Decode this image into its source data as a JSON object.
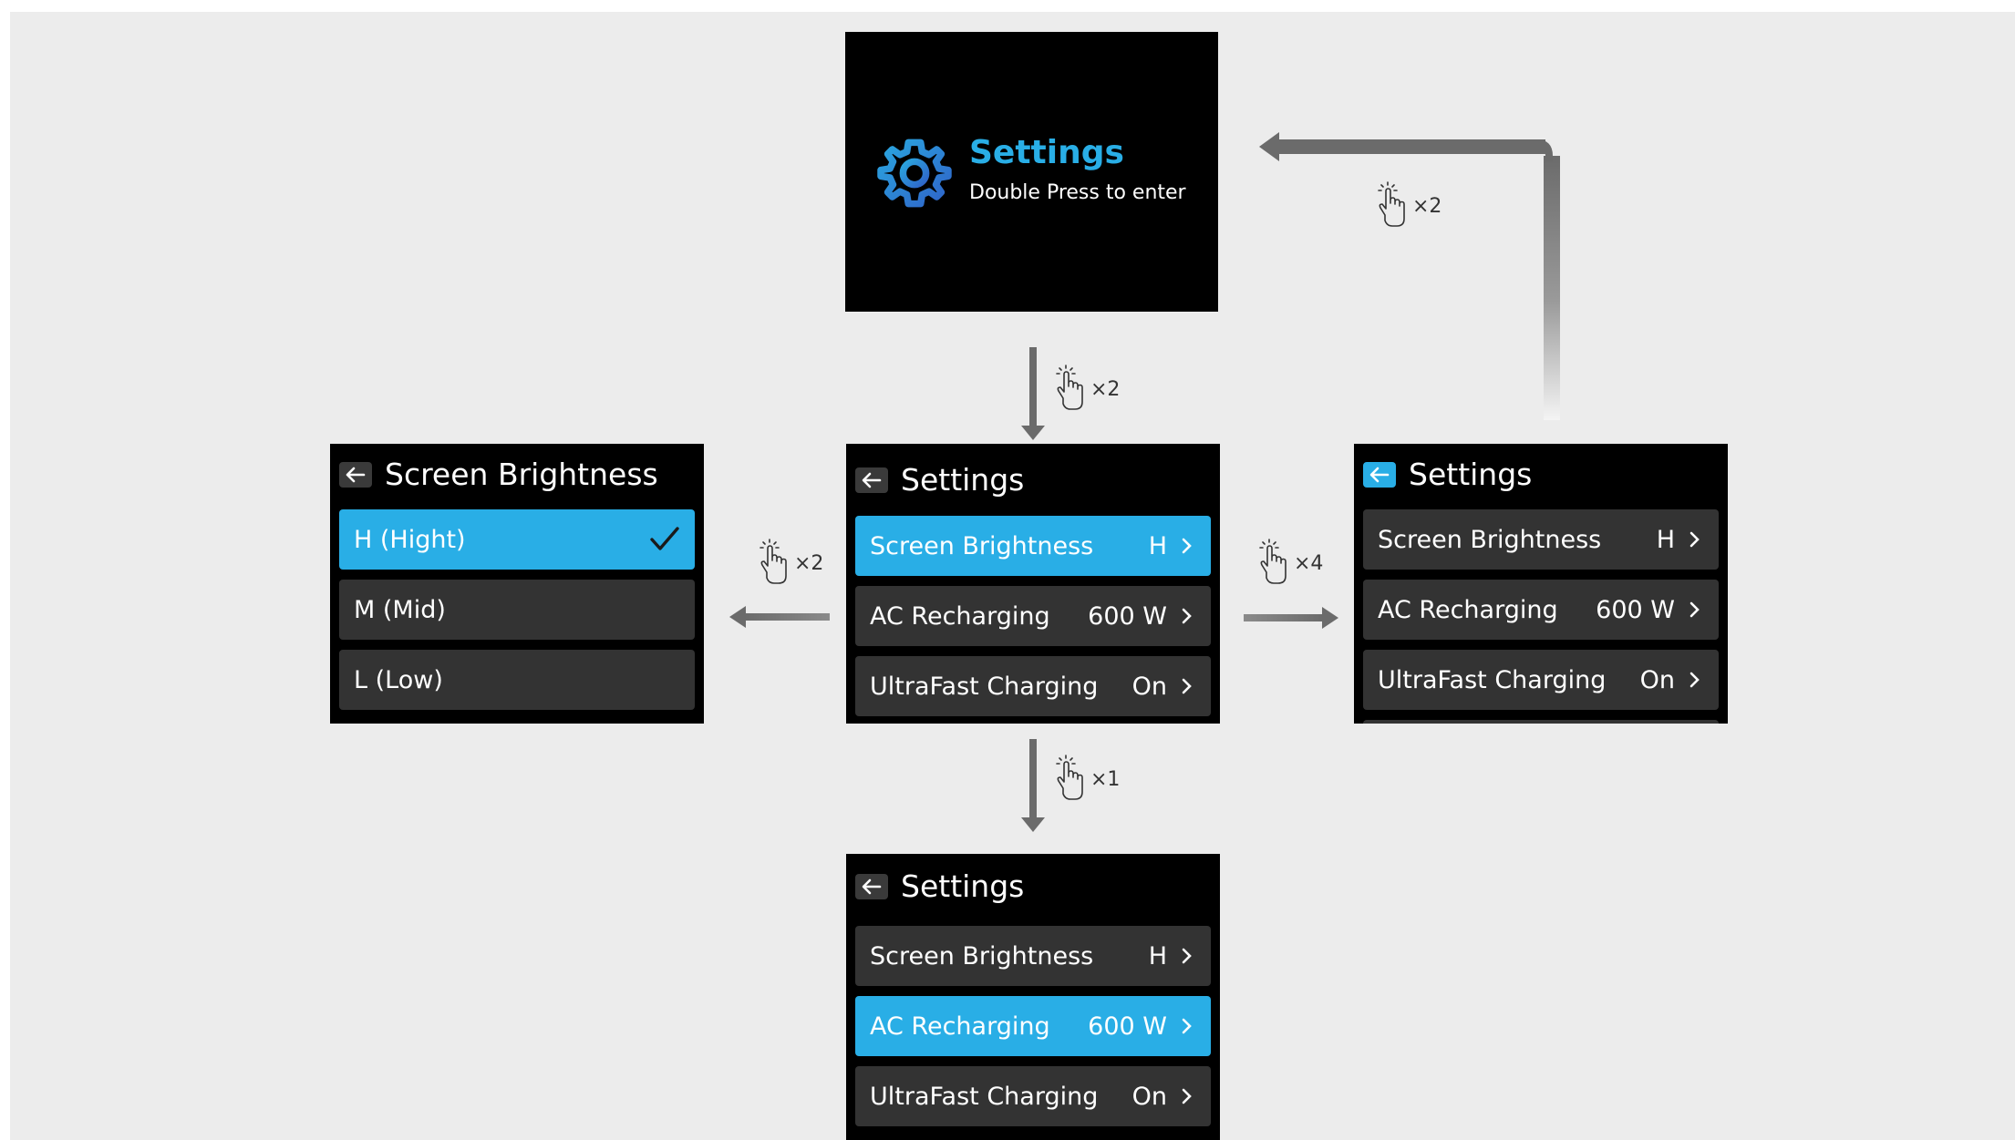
{
  "colors": {
    "accent": "#29aee6",
    "row_bg": "#333333",
    "canvas_bg": "#ececec",
    "arrow": "#6b6b6b"
  },
  "top_screen": {
    "title": "Settings",
    "subtitle": "Double Press to enter",
    "icon": "gear-icon"
  },
  "center_screen": {
    "title": "Settings",
    "rows": [
      {
        "label": "Screen Brightness",
        "value": "H"
      },
      {
        "label": "AC Recharging",
        "value": "600 W"
      },
      {
        "label": "UltraFast Charging",
        "value": "On"
      }
    ],
    "selected_index": 0
  },
  "left_screen": {
    "title": "Screen Brightness",
    "rows": [
      {
        "label": "H (Hight)"
      },
      {
        "label": "M (Mid)"
      },
      {
        "label": "L (Low)"
      }
    ],
    "selected_index": 0
  },
  "right_screen": {
    "title": "Settings",
    "rows": [
      {
        "label": "Screen Brightness",
        "value": "H"
      },
      {
        "label": "AC Recharging",
        "value": "600 W"
      },
      {
        "label": "UltraFast Charging",
        "value": "On"
      }
    ],
    "back_selected": true
  },
  "bottom_screen": {
    "title": "Settings",
    "rows": [
      {
        "label": "Screen Brightness",
        "value": "H"
      },
      {
        "label": "AC Recharging",
        "value": "600 W"
      },
      {
        "label": "UltraFast Charging",
        "value": "On"
      }
    ],
    "selected_index": 1
  },
  "transitions": {
    "top_to_center": "×2",
    "center_to_left": "×2",
    "center_to_right": "×4",
    "center_to_bottom": "×1",
    "right_to_top": "×2"
  }
}
